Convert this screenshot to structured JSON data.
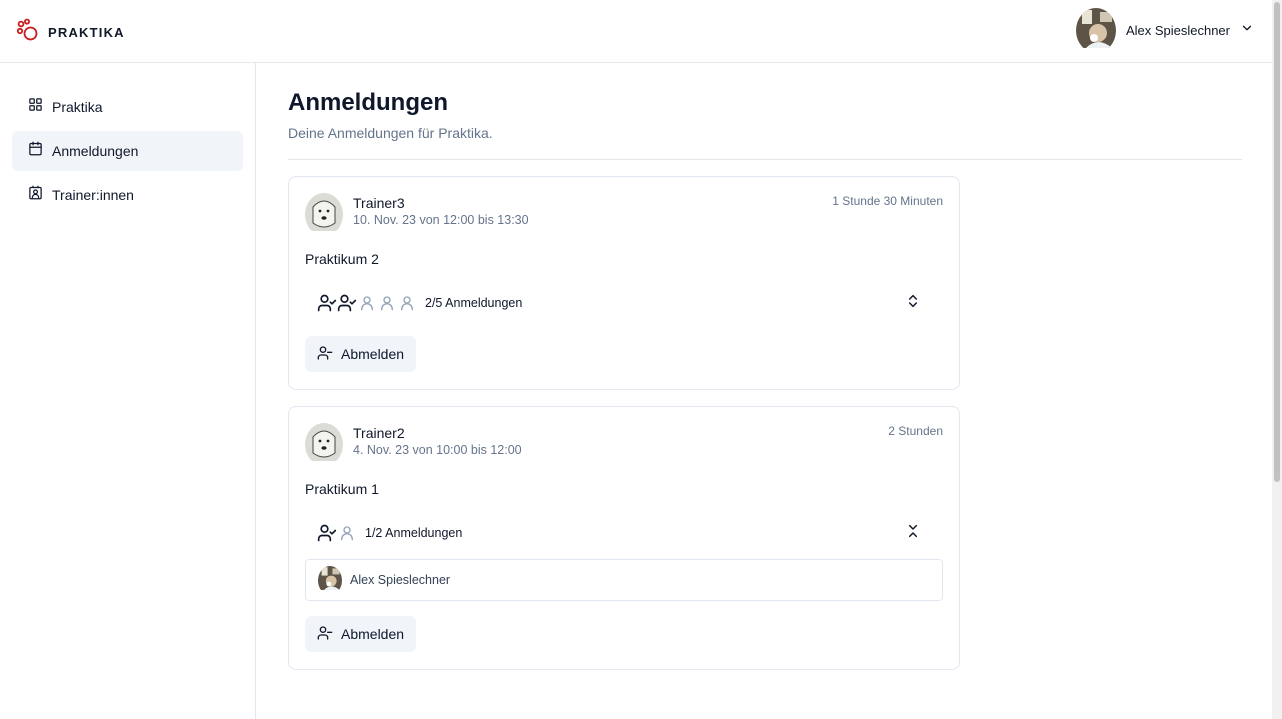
{
  "brand": {
    "name": "PRAKTIKA",
    "color": "#c81e1e"
  },
  "header": {
    "user_name": "Alex Spieslechner"
  },
  "sidebar": {
    "items": [
      {
        "label": "Praktika",
        "icon": "grid-icon",
        "active": false
      },
      {
        "label": "Anmeldungen",
        "icon": "calendar-icon",
        "active": true
      },
      {
        "label": "Trainer:innen",
        "icon": "contact-icon",
        "active": false
      }
    ]
  },
  "main": {
    "title": "Anmeldungen",
    "subtitle": "Deine Anmeldungen für Praktika.",
    "cards": [
      {
        "trainer": "Trainer3",
        "date": "10. Nov. 23 von 12:00 bis 13:30",
        "duration": "1 Stunde 30 Minuten",
        "course": "Praktikum 2",
        "registered": 2,
        "capacity": 5,
        "registrations_label": "2/5 Anmeldungen",
        "expanded": false,
        "participants": [],
        "action_label": "Abmelden"
      },
      {
        "trainer": "Trainer2",
        "date": "4. Nov. 23 von 10:00 bis 12:00",
        "duration": "2 Stunden",
        "course": "Praktikum 1",
        "registered": 1,
        "capacity": 2,
        "registrations_label": "1/2 Anmeldungen",
        "expanded": true,
        "participants": [
          "Alex Spieslechner"
        ],
        "action_label": "Abmelden"
      }
    ]
  },
  "colors": {
    "accent_bg": "#f1f5f9",
    "muted_text": "#64748b",
    "border": "#e2e8f0"
  }
}
